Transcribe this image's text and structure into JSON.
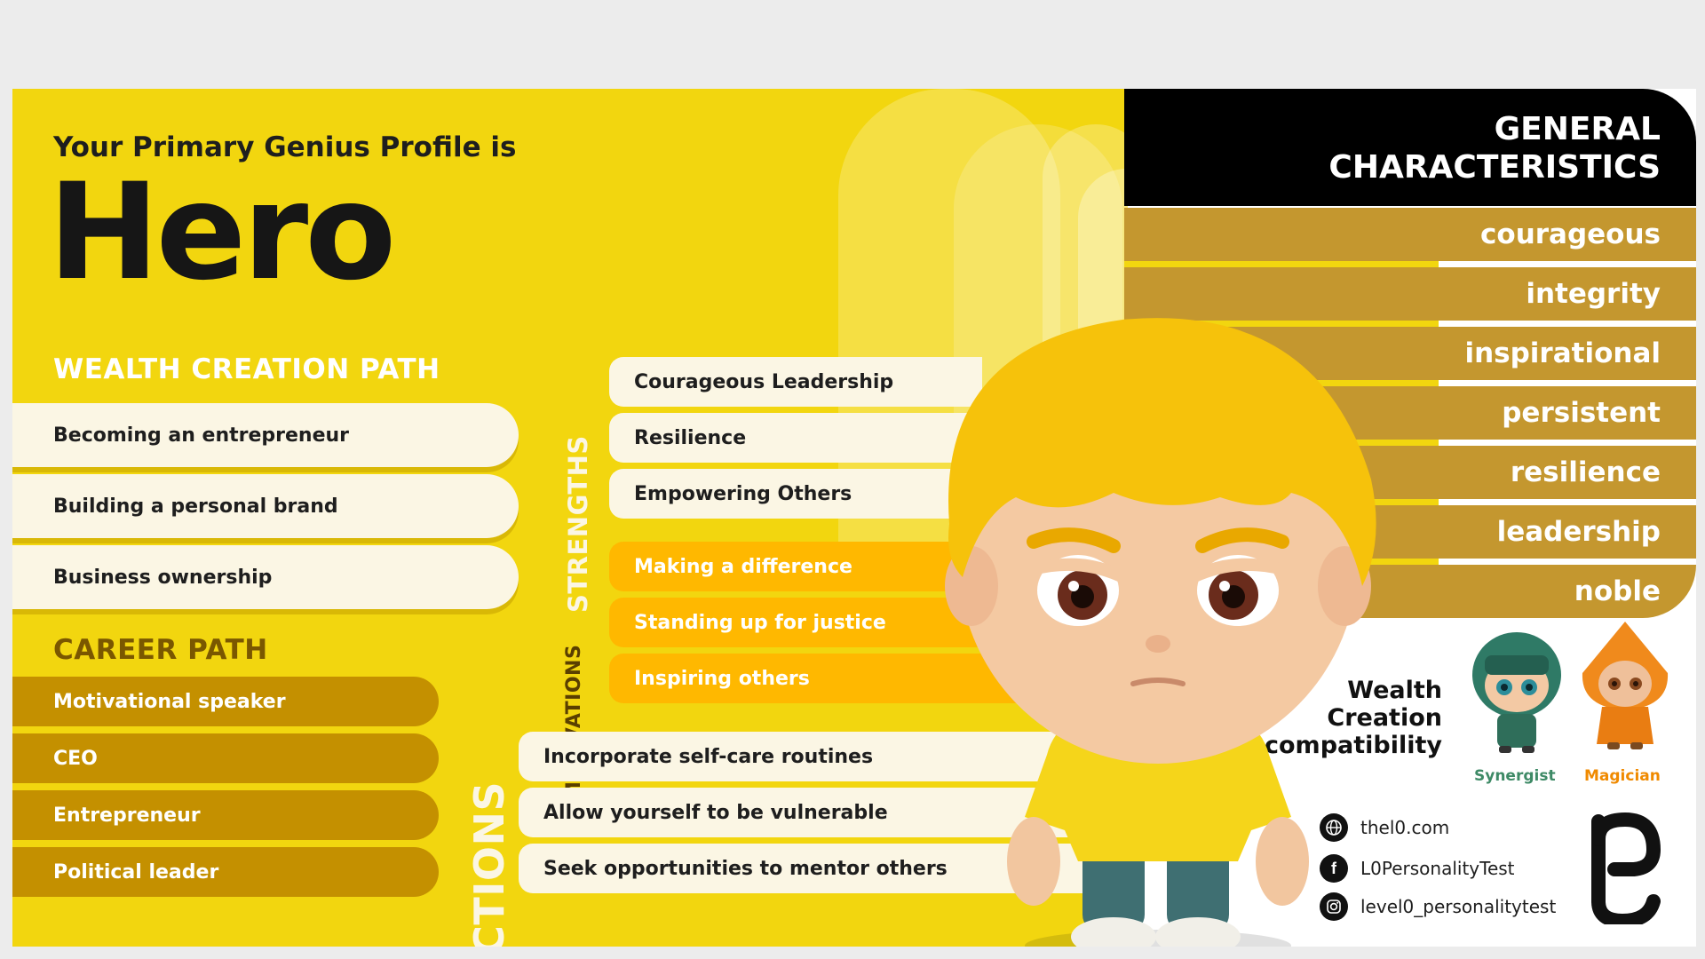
{
  "header": {
    "subtitle": "Your Primary Genius Profile is",
    "profile_name": "Hero"
  },
  "wealth_creation_path": {
    "title": "WEALTH CREATION PATH",
    "items": [
      "Becoming an entrepreneur",
      "Building a personal brand",
      "Business ownership"
    ]
  },
  "career_path": {
    "title": "CAREER PATH",
    "items": [
      "Motivational speaker",
      "CEO",
      "Entrepreneur",
      "Political leader"
    ]
  },
  "strengths": {
    "label": "STRENGTHS",
    "items": [
      "Courageous Leadership",
      "Resilience",
      "Empowering Others"
    ]
  },
  "motivations": {
    "label": "MOTIVATIONS",
    "items": [
      "Making a difference",
      "Standing up for justice",
      "Inspiring others"
    ]
  },
  "actions": {
    "label": "ACTIONS",
    "items": [
      "Incorporate self-care routines",
      "Allow yourself to be vulnerable",
      "Seek opportunities to mentor others"
    ]
  },
  "general_characteristics": {
    "title_line1": "GENERAL",
    "title_line2": "CHARACTERISTICS",
    "items": [
      "courageous",
      "integrity",
      "inspirational",
      "persistent",
      "resilience",
      "leadership",
      "noble"
    ]
  },
  "compatibility": {
    "line1": "Wealth",
    "line2": "Creation",
    "line3": "compatibility",
    "profiles": [
      "Synergist",
      "Magician"
    ]
  },
  "social": {
    "website": "thel0.com",
    "facebook": "L0PersonalityTest",
    "instagram": "level0_personalitytest"
  },
  "colors": {
    "yellow": "#f2d60f",
    "cream": "#fbf6e4",
    "gold": "#c49000",
    "orange": "#ffb800",
    "black": "#000000",
    "tan": "#c4972f"
  },
  "icons": {
    "website": "globe-icon",
    "facebook": "facebook-icon",
    "instagram": "instagram-icon",
    "logo": "level0-logo-icon"
  }
}
